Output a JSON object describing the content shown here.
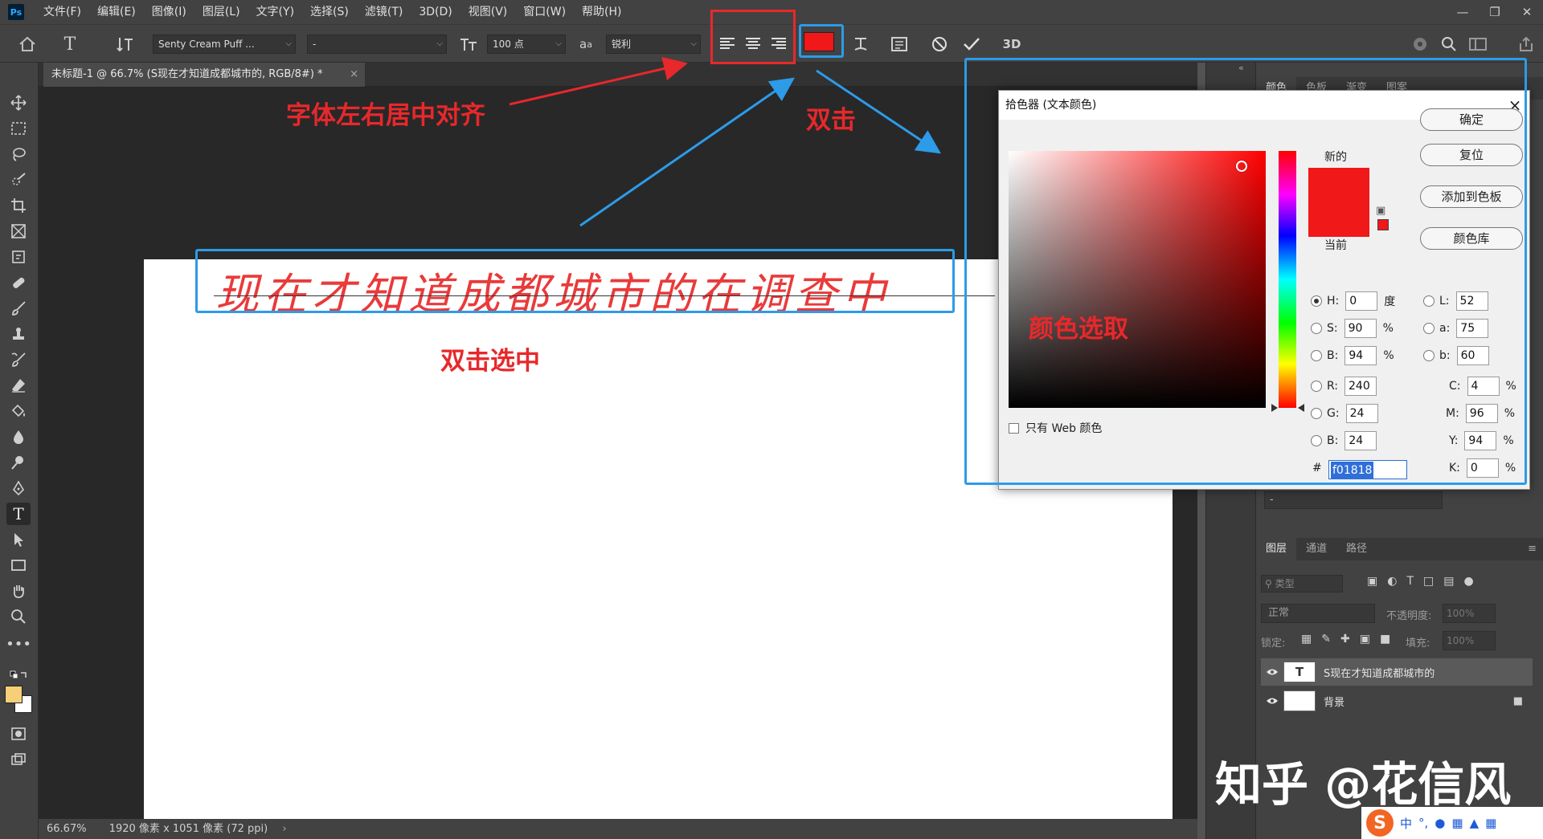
{
  "app": {
    "logo": "Ps",
    "menu": [
      "文件(F)",
      "编辑(E)",
      "图像(I)",
      "图层(L)",
      "文字(Y)",
      "选择(S)",
      "滤镜(T)",
      "3D(D)",
      "视图(V)",
      "窗口(W)",
      "帮助(H)"
    ]
  },
  "options": {
    "font_family": "Senty Cream Puff ...",
    "font_style": "-",
    "font_size": "100 点",
    "antialias": "锐利",
    "text_color": "#f01818"
  },
  "document": {
    "tab_title": "未标题-1 @ 66.7% (S现在才知道成都城市的, RGB/8#) *",
    "text_content": "现在才知道成都城市的在调查中"
  },
  "status": {
    "zoom": "66.67%",
    "doc_size": "1920 像素 x 1051 像素 (72 ppi)"
  },
  "right_top_tabs": [
    "颜色",
    "色板",
    "渐变",
    "图案"
  ],
  "layers": {
    "tabs": [
      "图层",
      "通道",
      "路径"
    ],
    "search_placeholder": "类型",
    "blend_mode": "正常",
    "opacity_label": "不透明度:",
    "opacity_value": "100%",
    "lock_label": "锁定:",
    "fill_label": "填充:",
    "fill_value": "100%",
    "items": [
      {
        "name": "S现在才知道成都城市的",
        "thumb": "T"
      },
      {
        "name": "背景"
      }
    ]
  },
  "color_picker": {
    "title": "拾色器 (文本颜色)",
    "new_label": "新的",
    "current_label": "当前",
    "web_only_label": "只有 Web 颜色",
    "buttons": {
      "ok": "确定",
      "reset": "复位",
      "add_swatch": "添加到色板",
      "color_libraries": "颜色库"
    },
    "hsb": {
      "h": "0",
      "h_unit": "度",
      "s": "90",
      "s_unit": "%",
      "b": "94",
      "b_unit": "%"
    },
    "rgb": {
      "r": "240",
      "g": "24",
      "b": "24"
    },
    "lab": {
      "l": "52",
      "a": "75",
      "b": "60"
    },
    "cmyk": {
      "c": "4",
      "m": "96",
      "y": "94",
      "k": "0",
      "unit": "%"
    },
    "hex": "f01818",
    "labels": {
      "H": "H:",
      "S": "S:",
      "B": "B:",
      "R": "R:",
      "G": "G:",
      "B2": "B:",
      "L": "L:",
      "a": "a:",
      "b": "b:",
      "C": "C:",
      "M": "M:",
      "Y": "Y:",
      "K": "K:",
      "hash": "#"
    },
    "new_color": "#f01818"
  },
  "annotations": {
    "align_note": "字体左右居中对齐",
    "double_click": "双击",
    "double_click_select": "双击选中",
    "color_pick": "颜色选取"
  },
  "watermark": "知乎 @花信风",
  "ime": {
    "label": "中"
  }
}
